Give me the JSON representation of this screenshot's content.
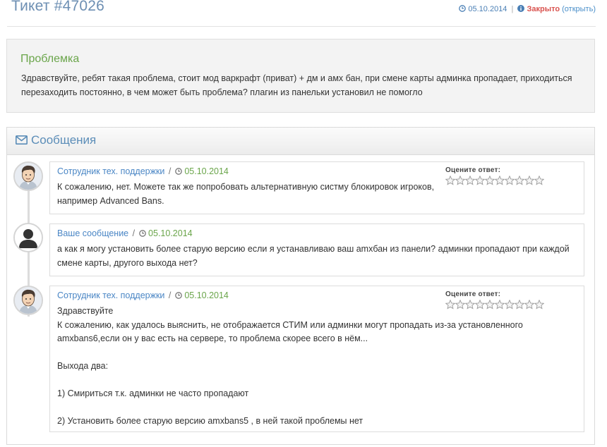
{
  "ticket": {
    "title": "Тикет #47026",
    "date": "05.10.2014",
    "separator": "|",
    "status": "Закрыто",
    "reopen": "(открыть)"
  },
  "problem": {
    "title": "Проблемка",
    "text": "Здравствуйте, ребят такая проблема, стоит мод варкрафт (приват) + дм и амх бан, при смене карты админка пропадает, приходиться перезаходить постоянно, в чем может быть проблема? плагин из панельки установил не помогло"
  },
  "messages": {
    "title": "Сообщения",
    "items": [
      {
        "author": "Сотрудник тех. поддержки",
        "date": "05.10.2014",
        "lines": [
          "К сожалению, нет. Можете так же попробовать альтернативную систму блокировок игроков, например Advanced Bans."
        ],
        "rating_label": "Оцените ответ:",
        "rating_stars": 10,
        "avatar": "staff-avatar"
      },
      {
        "author": "Ваше сообщение",
        "date": "05.10.2014",
        "lines": [
          "а как я могу установить более старую версию если я устанавливаю ваш amxбан из панели? админки пропадают при каждой смене карты, другого выхода нет?"
        ],
        "avatar": "user-avatar"
      },
      {
        "author": "Сотрудник тех. поддержки",
        "date": "05.10.2014",
        "lines": [
          "Здравствуйте",
          "К сожалению, как удалось выяснить, не отображается СТИМ или админки могут пропадать из-за установленного amxbans6,если он у вас есть на сервере, то проблема скорее всего в нём...",
          "",
          "Выхода два:",
          "",
          "1) Смириться т.к. админки не часто пропадают",
          "",
          "2) Установить более старую версию amxbans5 , в ней такой проблемы нет"
        ],
        "rating_label": "Оцените ответ:",
        "rating_stars": 10,
        "avatar": "staff-avatar"
      }
    ]
  },
  "colors": {
    "title": "#6d8fb3",
    "link": "#4a86c5",
    "date_green": "#6aa54a",
    "status_red": "#d9534f"
  }
}
